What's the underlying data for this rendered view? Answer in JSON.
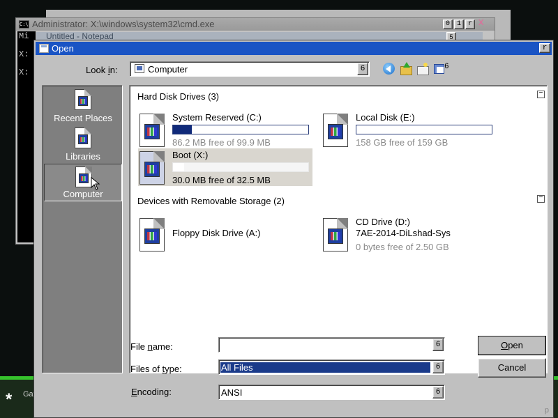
{
  "background": {
    "cmd_title": "Administrator: X:\\windows\\system32\\cmd.exe",
    "cmd_icon_text": "C:\\",
    "cmd_lines": [
      "Mi",
      "X:",
      "X:"
    ],
    "cmd_controls": [
      "0",
      "1",
      "r"
    ],
    "notepad_title": "Untitled - Notepad",
    "notepad_control": "5",
    "close_mark": "x",
    "taskbar_text": "Gat",
    "start_symbol": "*"
  },
  "dialog": {
    "title": "Open",
    "close_glyph": "r",
    "look_in": {
      "label_pre": "Look ",
      "label_underlined": "i",
      "label_post": "n:",
      "value": "Computer",
      "dropdown_glyph": "6"
    },
    "toolbar": {
      "views_dropdown_glyph": "6"
    },
    "places": [
      {
        "label": "Recent Places"
      },
      {
        "label": "Libraries"
      },
      {
        "label": "Computer",
        "selected": true
      }
    ],
    "groups": [
      {
        "title": "Hard Disk Drives (3)",
        "collapse_glyph": "−"
      },
      {
        "title": "Devices with Removable Storage (2)",
        "collapse_glyph": "−"
      }
    ],
    "drives": [
      {
        "name": "System Reserved (C:)",
        "free": "86.2 MB free of 99.9 MB",
        "used_fraction": 0.14
      },
      {
        "name": "Local Disk (E:)",
        "free": "158 GB free of 159 GB",
        "used_fraction": 0.0
      },
      {
        "name": "Boot (X:)",
        "free": "30.0 MB free of 32.5 MB",
        "used_fraction": 0.08
      }
    ],
    "removable": [
      {
        "name": "Floppy Disk Drive (A:)"
      },
      {
        "name": "CD Drive (D:)",
        "label": "7AE-2014-DiLshad-Sys",
        "free": "0 bytes free of 2.50 GB"
      }
    ],
    "file_name": {
      "label_pre": "File ",
      "label_underlined": "n",
      "label_post": "ame:",
      "value": "",
      "dropdown_glyph": "6"
    },
    "files_of_type": {
      "label_pre": "Files of ",
      "label_underlined": "t",
      "label_post": "ype:",
      "value": "All Files",
      "dropdown_glyph": "6"
    },
    "encoding": {
      "label_pre": "",
      "label_underlined": "E",
      "label_post": "ncoding:",
      "value": "ANSI",
      "dropdown_glyph": "6"
    },
    "open_button": {
      "label_underlined": "O",
      "label_post": "pen"
    },
    "cancel_button": "Cancel",
    "grip": "p"
  }
}
